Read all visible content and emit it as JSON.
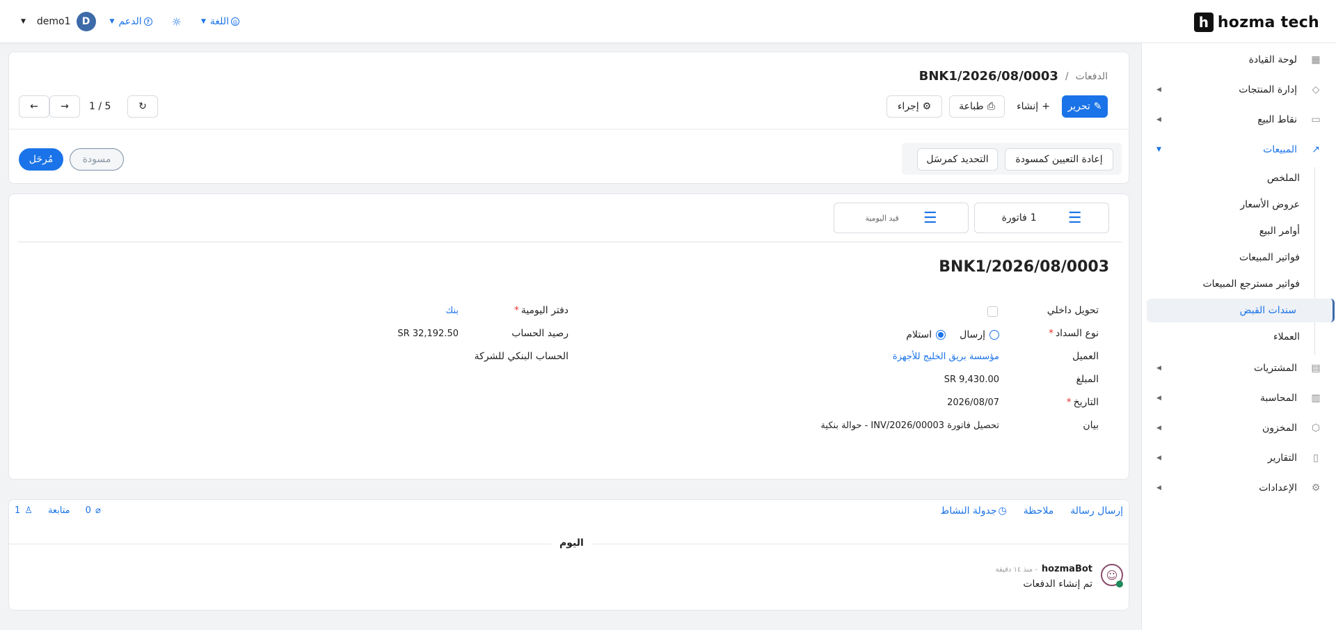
{
  "brand": {
    "name": "hozma tech",
    "mark": "h"
  },
  "topnav": {
    "user_name": "demo1",
    "avatar_letter": "D",
    "support_label": "الدعم",
    "language_label": "اللغة"
  },
  "sidebar": {
    "items": [
      {
        "label": "لوحة القيادة"
      },
      {
        "label": "إدارة المنتجات"
      },
      {
        "label": "نقاط البيع"
      },
      {
        "label": "المبيعات"
      },
      {
        "label": "المشتريات"
      },
      {
        "label": "المحاسبة"
      },
      {
        "label": "المخزون"
      },
      {
        "label": "التقارير"
      },
      {
        "label": "الإعدادات"
      }
    ],
    "sales_sub": [
      {
        "label": "الملخص"
      },
      {
        "label": "عروض الأسعار"
      },
      {
        "label": "أوامر البيع"
      },
      {
        "label": "فواتير المبيعات"
      },
      {
        "label": "فواتير مسترجع المبيعات"
      },
      {
        "label": "سندات القبض"
      },
      {
        "label": "العملاء"
      }
    ]
  },
  "header": {
    "breadcrumb_parent": "الدفعات",
    "breadcrumb_sep": "/",
    "record_name": "BNK1/2026/08/0003",
    "edit_label": "تحرير",
    "create_label": "إنشاء",
    "print_label": "طباعة",
    "action_label": "إجراء",
    "pager": "1 / 5"
  },
  "statusbar": {
    "reset_draft_label": "إعادة التعيين كمسودة",
    "mark_sent_label": "التحديد كمرسَل",
    "state_draft": "مسودة",
    "state_posted": "مُرحَل"
  },
  "smart_buttons": {
    "invoice_count": "1",
    "invoice_label": "فاتورة",
    "journal_label": "قيد اليومية"
  },
  "form": {
    "title": "BNK1/2026/08/0003",
    "internal_transfer_label": "تحويل داخلي",
    "payment_type_label": "نوع السداد",
    "payment_type_send": "إرسال",
    "payment_type_receive": "استلام",
    "customer_label": "العميل",
    "customer_value": "مؤسسة بريق الخليج للأجهزة",
    "amount_label": "المبلغ",
    "amount_value": "SR 9,430.00",
    "date_label": "التاريخ",
    "date_value": "2026/08/07",
    "memo_label": "بيان",
    "memo_value": "تحصيل فاتورة INV/2026/00003 - حوالة بنكية",
    "journal_label": "دفتر اليومية",
    "journal_value": "بنك",
    "balance_label": "رصيد الحساب",
    "balance_value": "SR 32,192.50",
    "bank_account_value": "الحساب البنكي للشركة"
  },
  "chatter": {
    "send_message": "إرسال رسالة",
    "note": "ملاحظة",
    "schedule_activity": "جدولة النشاط",
    "attachments_count": "0",
    "follow_label": "متابعة",
    "followers_count": "1",
    "today_label": "اليوم",
    "author": "hozmaBot",
    "time_ago": "- منذ ١٤ دقيقة",
    "message": "تم إنشاء الدفعات"
  }
}
